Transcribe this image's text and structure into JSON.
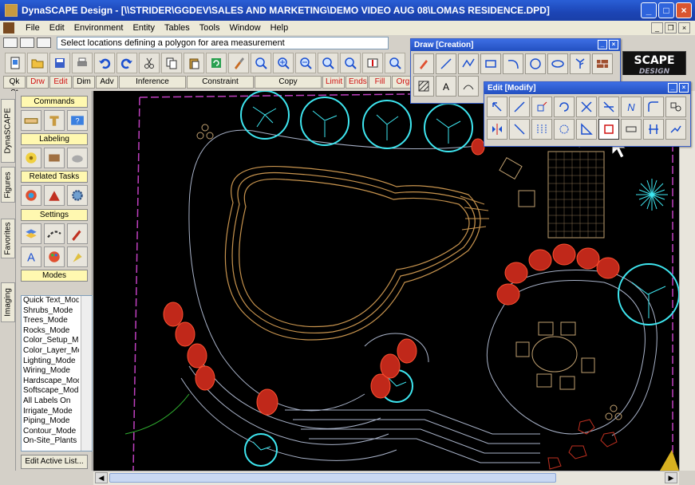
{
  "window": {
    "title": "DynaSCAPE Design  - [\\\\STRIDER\\GGDEV\\SALES AND MARKETING\\DEMO VIDEO AUG 08\\LOMAS RESIDENCE.DPD]",
    "buttons": {
      "minimize": "_",
      "maximize": "□",
      "close": "×"
    }
  },
  "menu": {
    "items": [
      "File",
      "Edit",
      "Environment",
      "Entity",
      "Tables",
      "Tools",
      "Window",
      "Help"
    ],
    "mdi": {
      "minimize": "_",
      "restore": "❐",
      "close": "×"
    }
  },
  "command": {
    "prompt": "Select locations defining a polygon for area measurement"
  },
  "tabs": {
    "items": [
      "Qk St",
      "Drw",
      "Edit",
      "Dim",
      "Adv",
      "Inference",
      "Constraint",
      "Copy",
      "Limit",
      "Ends",
      "Fill",
      "Org"
    ],
    "red_items": [
      "Drw",
      "Edit",
      "Limit",
      "Ends",
      "Fill",
      "Org"
    ]
  },
  "vtabs": [
    "DynaSCAPE",
    "Figures",
    "Favorites",
    "Imaging"
  ],
  "panel": {
    "sections": [
      "Commands",
      "Labeling",
      "Related Tasks",
      "Settings",
      "Modes"
    ],
    "modes": [
      "Quick Text_Mode",
      "Shrubs_Mode",
      "Trees_Mode",
      "Rocks_Mode",
      "Color_Setup_Mode",
      "Color_Layer_Mode",
      "Lighting_Mode",
      "Wiring_Mode",
      "Hardscape_Mode",
      "Softscape_Mode",
      "All Labels On",
      "Irrigate_Mode",
      "Piping_Mode",
      "Contour_Mode",
      "On-Site_Plants"
    ],
    "edit_active": "Edit Active List..."
  },
  "palettes": {
    "draw_title": "Draw [Creation]",
    "edit_title": "Edit [Modify]",
    "close": "×"
  },
  "logo": {
    "main": "SCAPE",
    "sub": "DESIGN"
  },
  "colors": {
    "tree": "#3ee6f0",
    "shrub": "#e03a20",
    "pool": "#c8944e",
    "path": "#a8b2c8",
    "deck": "#c0a070",
    "boundary": "#c040c0"
  }
}
